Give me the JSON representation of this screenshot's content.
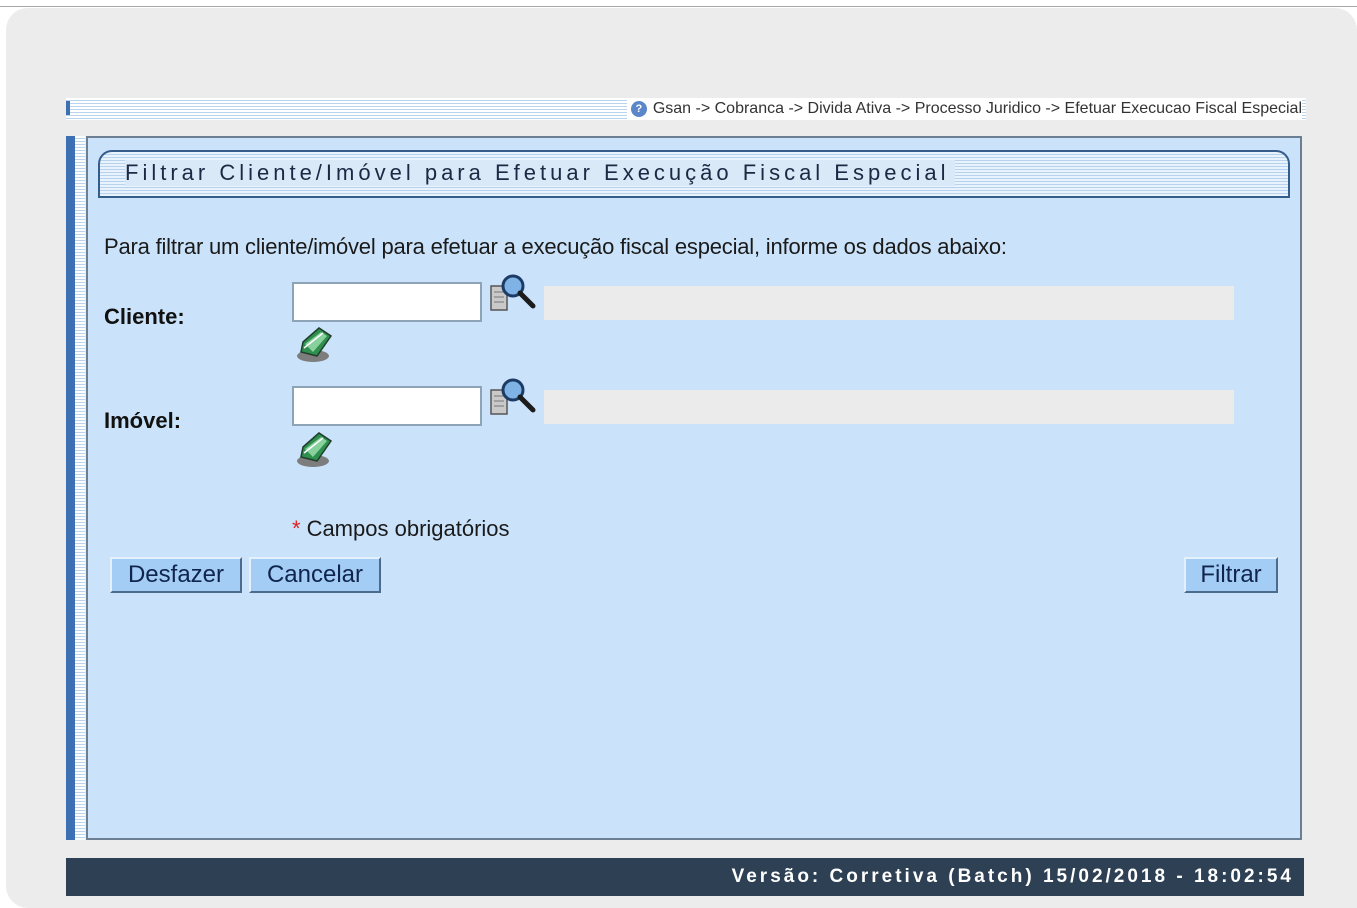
{
  "breadcrumb": {
    "text": "Gsan -> Cobranca -> Divida Ativa -> Processo Juridico -> Efetuar Execucao Fiscal Especial"
  },
  "form": {
    "title": "Filtrar Cliente/Imóvel para Efetuar Execução Fiscal Especial",
    "instructions": "Para filtrar um cliente/imóvel para efetuar a execução fiscal especial, informe os dados abaixo:",
    "fields": {
      "cliente": {
        "label": "Cliente:",
        "value": "",
        "description": ""
      },
      "imovel": {
        "label": "Imóvel:",
        "value": "",
        "description": ""
      }
    },
    "required_note": {
      "asterisk": "*",
      "text": "Campos obrigatórios"
    }
  },
  "buttons": {
    "desfazer": "Desfazer",
    "cancelar": "Cancelar",
    "filtrar": "Filtrar"
  },
  "footer": {
    "version": "Versão: Corretiva (Batch) 15/02/2018 - 18:02:54"
  },
  "icons": {
    "help": "help-icon",
    "search": "search-icon",
    "eraser": "eraser-icon"
  },
  "colors": {
    "panel_bg": "#cbe3fa",
    "button_bg": "#a3cdf5",
    "footer_bg": "#2e4054",
    "accent_blue": "#3d6fb3",
    "required": "#e0211f"
  }
}
